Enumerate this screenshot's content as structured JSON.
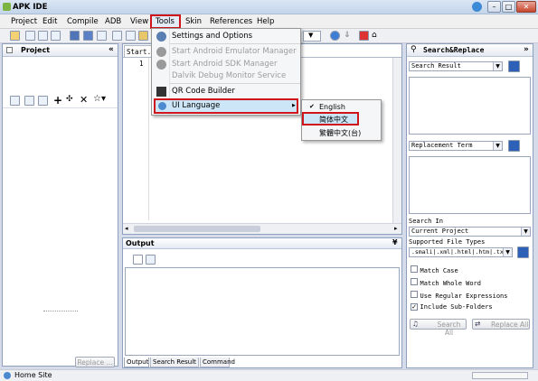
{
  "window": {
    "title": "APK IDE",
    "minimize": "–",
    "maximize": "□",
    "close": "✕"
  },
  "menubar": {
    "items": [
      {
        "label": "Project",
        "accel": "P"
      },
      {
        "label": "Edit",
        "accel": "E"
      },
      {
        "label": "Compile",
        "accel": "C"
      },
      {
        "label": "ADB",
        "accel": "A"
      },
      {
        "label": "View",
        "accel": "V"
      },
      {
        "label": "Tools",
        "accel": "T"
      },
      {
        "label": "Skin",
        "accel": "S"
      },
      {
        "label": "References",
        "accel": "R"
      },
      {
        "label": "Help",
        "accel": "H"
      }
    ]
  },
  "tools_menu": {
    "items": [
      {
        "label": "Settings and Options",
        "disabled": false
      },
      {
        "label": "Start Android Emulator Manager",
        "disabled": true
      },
      {
        "label": "Start Android SDK Manager",
        "disabled": true
      },
      {
        "label": "Dalvik Debug Monitor Service",
        "disabled": true
      },
      {
        "label": "QR Code Builder",
        "disabled": false
      },
      {
        "label": "UI Language",
        "disabled": false
      }
    ],
    "submenu_arrow": "▶"
  },
  "language_menu": {
    "items": [
      {
        "label": "English",
        "checked": true,
        "check": "✔"
      },
      {
        "label": "简体中文",
        "checked": false
      },
      {
        "label": "繁體中文(台)",
        "checked": false
      }
    ]
  },
  "project_panel": {
    "title": "Project",
    "collapse": "«",
    "replace_button": "Replace ..."
  },
  "editor": {
    "tab_label": "Start.ja",
    "line_number": "1"
  },
  "output_panel": {
    "title": "Output",
    "toggle": "¥",
    "tabs": [
      "Output",
      "Search Result",
      "Command"
    ]
  },
  "search_panel": {
    "title": "Search&Replace",
    "expand": "»",
    "search_result_label": "Search Result",
    "replacement_label": "Replacement Term",
    "search_in_label": "Search In",
    "search_in_value": "Current Project",
    "file_types_label": "Supported File Types",
    "file_types_value": ".smali|.xml|.html|.htm|.txt",
    "options": [
      {
        "label": "Match Case",
        "checked": false
      },
      {
        "label": "Match Whole Word",
        "checked": false
      },
      {
        "label": "Use Regular Expressions",
        "checked": false
      },
      {
        "label": "Include Sub-Folders",
        "checked": true
      }
    ],
    "search_all_button": "Search All",
    "replace_all_button": "Replace All"
  },
  "statusbar": {
    "text": "Home Site"
  },
  "colors": {
    "highlight_border": "#d0141c",
    "menu_hover": "#cde6f7"
  }
}
